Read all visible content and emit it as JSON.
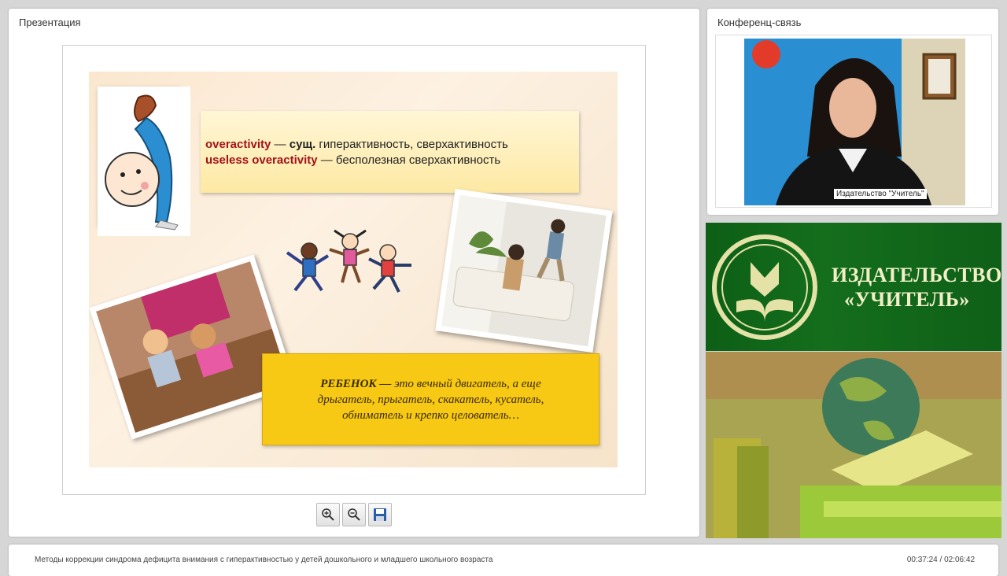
{
  "presentation": {
    "panel_title": "Презентация",
    "slide": {
      "definition_line1": {
        "term": "overactivity",
        "dash": " — ",
        "pos": "сущ.",
        "rest": " гиперактивность, сверхактивность"
      },
      "definition_line2": {
        "term": "useless overactivity",
        "rest": " — бесполезная сверхактивность"
      },
      "quote": {
        "bold": "РЕБЕНОК —",
        "line1_rest": " это вечный двигатель, а еще",
        "line2": "дрыгатель, прыгатель, скакатель, кусатель,",
        "line3": "обниматель и крепко целователь…"
      }
    },
    "toolbar": {
      "zoom_in": "zoom-in-icon",
      "zoom_out": "zoom-out-icon",
      "save": "save-icon"
    }
  },
  "conference": {
    "panel_title": "Конференц-связь",
    "video_caption": "Издательство \"Учитель\""
  },
  "brand": {
    "line1": "ИЗДАТЕЛЬСТВО",
    "line2": "«УЧИТЕЛЬ»"
  },
  "bottom": {
    "title": "Методы коррекции синдрома дефицита внимания с гиперактивностью у детей дошкольного и младшего школьного возраста",
    "time": "00:37:24 / 02:06:42"
  },
  "colors": {
    "term": "#a3121a",
    "quote_bg": "#f7c915",
    "brand_green": "#146e1c"
  }
}
